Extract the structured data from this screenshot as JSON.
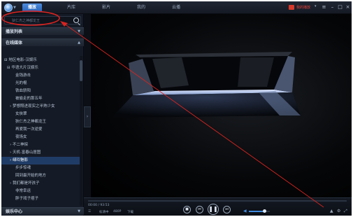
{
  "header": {
    "tabs": [
      {
        "label": "播放",
        "active": true
      },
      {
        "label": "片库",
        "active": false
      },
      {
        "label": "影片",
        "active": false
      },
      {
        "label": "我的",
        "active": false
      },
      {
        "label": "云播",
        "active": false
      }
    ],
    "user_name": "我的播放"
  },
  "sidebar": {
    "search_placeholder": "狄仁杰之神都龙王",
    "playlist_header": "播放列表",
    "online_header": "在线媒体",
    "entertainment_header": "娱乐中心",
    "items": [
      {
        "label": "⊟ 地区电影-汉娱乐",
        "indent": 4,
        "selected": false
      },
      {
        "label": "⊟ 华语大片汉娱乐",
        "indent": 8,
        "selected": false
      },
      {
        "label": "金钱游击",
        "indent": 20,
        "selected": false
      },
      {
        "label": "光的棍",
        "indent": 20,
        "selected": false
      },
      {
        "label": "铁血骄阳",
        "indent": 20,
        "selected": false
      },
      {
        "label": "被偷走的那五年",
        "indent": 20,
        "selected": false
      },
      {
        "label": "› 梦想照进现实之半熟少女",
        "indent": 12,
        "selected": false
      },
      {
        "label": "女侠翠",
        "indent": 20,
        "selected": false
      },
      {
        "label": "狄仁杰之神都龙王",
        "indent": 20,
        "selected": false
      },
      {
        "label": "再爱我一次逆爱",
        "indent": 20,
        "selected": false
      },
      {
        "label": "夜场女",
        "indent": 20,
        "selected": false
      },
      {
        "label": "› 不二神探",
        "indent": 12,
        "selected": false
      },
      {
        "label": "› 天机·富春山居图",
        "indent": 12,
        "selected": false
      },
      {
        "label": "› 绿玲魅影",
        "indent": 12,
        "selected": true
      },
      {
        "label": "步步惊魂",
        "indent": 20,
        "selected": false
      },
      {
        "label": "回到最开始的地方",
        "indent": 20,
        "selected": false
      },
      {
        "label": "› 我们都是坏孩子",
        "indent": 12,
        "selected": false
      },
      {
        "label": "非常幸运",
        "indent": 20,
        "selected": false
      },
      {
        "label": "胖子戏子痞子",
        "indent": 20,
        "selected": false
      }
    ]
  },
  "player": {
    "time_current": "00:00",
    "time_total": "93:53",
    "quality_label": "标清中",
    "resolution_label": "480P",
    "download_label": "下载",
    "progress": 0.0,
    "volume": 0.75
  },
  "icons": {
    "logo": "player-logo-icon",
    "search": "search-icon",
    "collapse": "chevron-right-icon"
  },
  "colors": {
    "accent": "#3f8ae0",
    "annotation": "#d9231f",
    "user": "#e8403a"
  }
}
